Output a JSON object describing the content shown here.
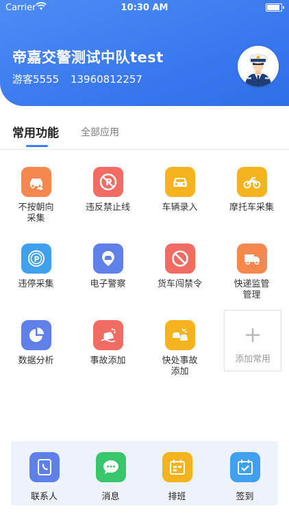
{
  "status_bar": {
    "carrier": "Carrier",
    "time": "10:30 AM"
  },
  "profile": {
    "unit_name": "帝嘉交警测试中队test",
    "user_name": "游客5555",
    "phone": "13960812257"
  },
  "tabs": {
    "common": "常用功能",
    "all_apps": "全部应用"
  },
  "functions": [
    {
      "label": "不按朝向\n采集",
      "icon": "car-direction-icon",
      "color": "#f5884f"
    },
    {
      "label": "违反禁止线",
      "icon": "no-parking-sign-icon",
      "color": "#f26c63"
    },
    {
      "label": "车辆录入",
      "icon": "car-icon",
      "color": "#f5b31d"
    },
    {
      "label": "摩托车采集",
      "icon": "motorcycle-icon",
      "color": "#f5b31d"
    },
    {
      "label": "违停采集",
      "icon": "parking-icon",
      "color": "#3fa0ee"
    },
    {
      "label": "电子警察",
      "icon": "camera-car-icon",
      "color": "#5e80e8"
    },
    {
      "label": "货车闯禁令",
      "icon": "prohibited-icon",
      "color": "#f26c63"
    },
    {
      "label": "快递监管\n管理",
      "icon": "delivery-truck-icon",
      "color": "#f5884f"
    },
    {
      "label": "数据分析",
      "icon": "pie-chart-icon",
      "color": "#5e80e8"
    },
    {
      "label": "事故添加",
      "icon": "accident-icon",
      "color": "#f26c63"
    },
    {
      "label": "快处事故\n添加",
      "icon": "quick-accident-icon",
      "color": "#f5b31d"
    }
  ],
  "add_common": {
    "label": "添加常用",
    "icon": "plus-icon"
  },
  "bottom_bar": [
    {
      "label": "联系人",
      "icon": "contacts-icon",
      "color": "#5e80e8"
    },
    {
      "label": "消息",
      "icon": "message-icon",
      "color": "#39c66b"
    },
    {
      "label": "排班",
      "icon": "schedule-icon",
      "color": "#f5b31d"
    },
    {
      "label": "签到",
      "icon": "checkin-icon",
      "color": "#3fa0ee"
    }
  ]
}
